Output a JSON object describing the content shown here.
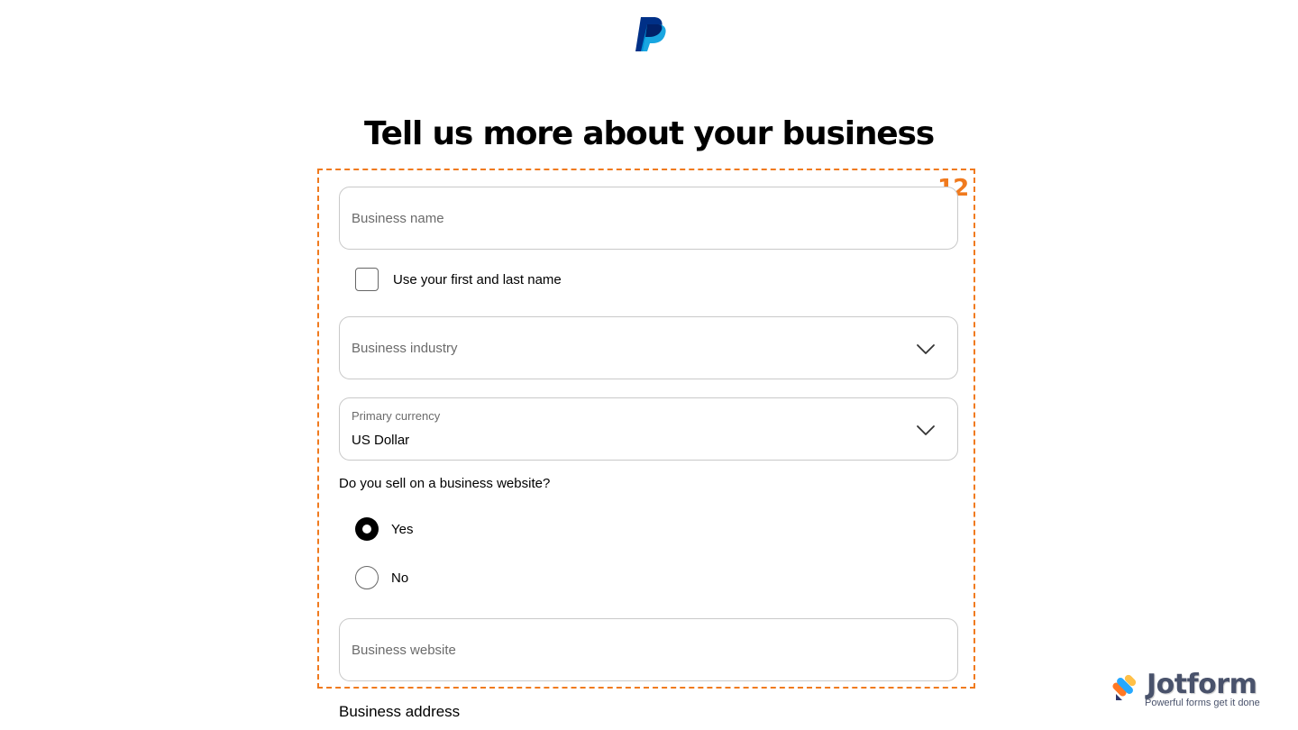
{
  "header": {
    "logo_icon": "paypal-logo-icon",
    "title": "Tell us more about your business"
  },
  "annotation": {
    "number": "12",
    "color": "#f07a1e"
  },
  "form": {
    "business_name": {
      "placeholder": "Business name",
      "value": ""
    },
    "use_name_checkbox": {
      "label": "Use your first and last name",
      "checked": false
    },
    "business_industry": {
      "placeholder": "Business industry",
      "icon": "chevron-down-icon"
    },
    "primary_currency": {
      "label": "Primary currency",
      "value": "US Dollar",
      "icon": "chevron-down-icon"
    },
    "website_question": {
      "label": "Do you sell on a business website?",
      "options": [
        {
          "label": "Yes",
          "selected": true
        },
        {
          "label": "No",
          "selected": false
        }
      ]
    },
    "business_website": {
      "placeholder": "Business website",
      "value": ""
    },
    "business_address_heading": "Business address"
  },
  "watermark": {
    "name": "Jotform",
    "tagline": "Powerful forms get it done",
    "icon": "jotform-logo-icon"
  }
}
